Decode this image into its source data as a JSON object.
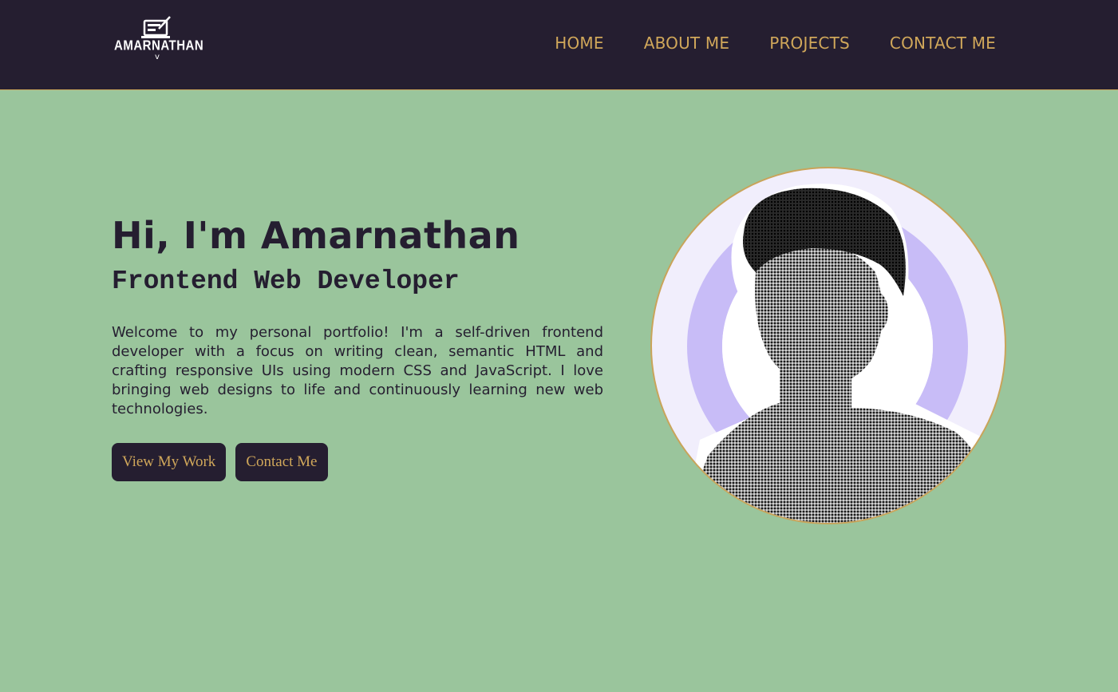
{
  "header": {
    "logo_text": "AMARNATHAN",
    "logo_caret": "v",
    "nav": [
      {
        "label": "HOME"
      },
      {
        "label": "ABOUT ME"
      },
      {
        "label": "PROJECTS"
      },
      {
        "label": "CONTACT ME"
      }
    ]
  },
  "hero": {
    "title": "Hi, I'm Amarnathan",
    "subtitle": "Frontend Web Developer",
    "description": "Welcome to my personal portfolio! I'm a self-driven frontend developer with a focus on writing clean, semantic HTML and crafting responsive UIs using modern CSS and JavaScript. I love bringing web designs to life and continuously learning new web technologies.",
    "buttons": {
      "view_work": "View My Work",
      "contact": "Contact Me"
    }
  },
  "colors": {
    "navbar_bg": "#251e30",
    "accent": "#d0a75a",
    "page_bg": "#9ac59c",
    "portrait_ring": "#c8bcf7"
  },
  "icons": {
    "logo": "laptop-pen-icon"
  }
}
